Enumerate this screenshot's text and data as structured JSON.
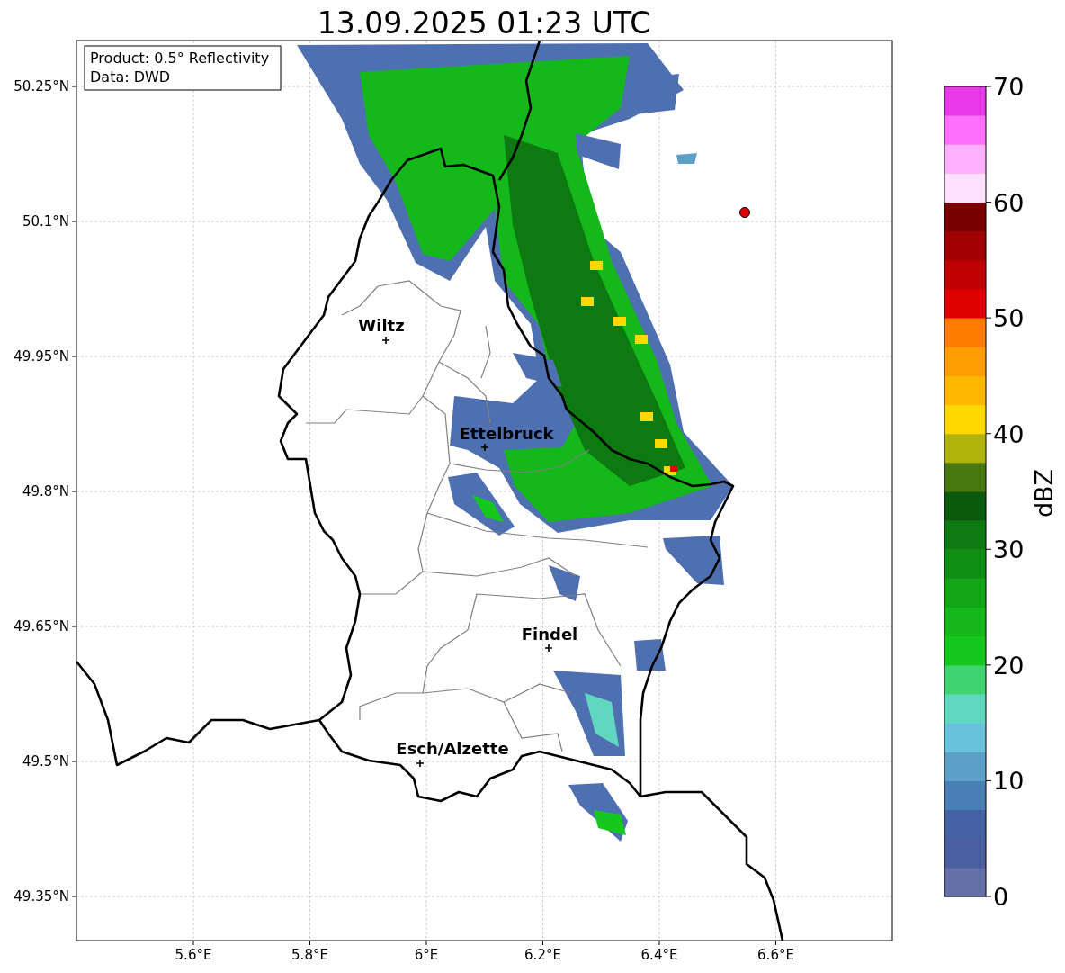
{
  "title": "13.09.2025 01:23 UTC",
  "info_box": {
    "lines": [
      "Product: 0.5° Reflectivity",
      "Data: DWD"
    ]
  },
  "lat_ticks": [
    "50.25°N",
    "50.1°N",
    "49.95°N",
    "49.8°N",
    "49.65°N",
    "49.5°N",
    "49.35°N"
  ],
  "lon_ticks": [
    "5.6°E",
    "5.8°E",
    "6°E",
    "6.2°E",
    "6.4°E",
    "6.6°E"
  ],
  "cities": [
    {
      "name": "Wiltz"
    },
    {
      "name": "Ettelbruck"
    },
    {
      "name": "Findel"
    },
    {
      "name": "Esch/Alzette"
    }
  ],
  "colorbar": {
    "label": "dBZ",
    "ticks": [
      "70",
      "60",
      "50",
      "40",
      "30",
      "20",
      "10",
      "0"
    ],
    "bins": [
      {
        "color": "#6470a8"
      },
      {
        "color": "#4a5ea0"
      },
      {
        "color": "#4462a4"
      },
      {
        "color": "#4a7fb6"
      },
      {
        "color": "#5ca0c8"
      },
      {
        "color": "#68c2dc"
      },
      {
        "color": "#60d8c0"
      },
      {
        "color": "#40d470"
      },
      {
        "color": "#14c81e"
      },
      {
        "color": "#14b81a"
      },
      {
        "color": "#12a616"
      },
      {
        "color": "#0e8e12"
      },
      {
        "color": "#0c7a10"
      },
      {
        "color": "#0a5a0c"
      },
      {
        "color": "#4a7810"
      },
      {
        "color": "#b0b40a"
      },
      {
        "color": "#ffd800"
      },
      {
        "color": "#ffb800"
      },
      {
        "color": "#ff9c00"
      },
      {
        "color": "#ff7c00"
      },
      {
        "color": "#e00000"
      },
      {
        "color": "#c00000"
      },
      {
        "color": "#a00000"
      },
      {
        "color": "#7a0000"
      },
      {
        "color": "#ffe0ff"
      },
      {
        "color": "#ffb0ff"
      },
      {
        "color": "#ff70ff"
      },
      {
        "color": "#e838e8"
      }
    ]
  }
}
